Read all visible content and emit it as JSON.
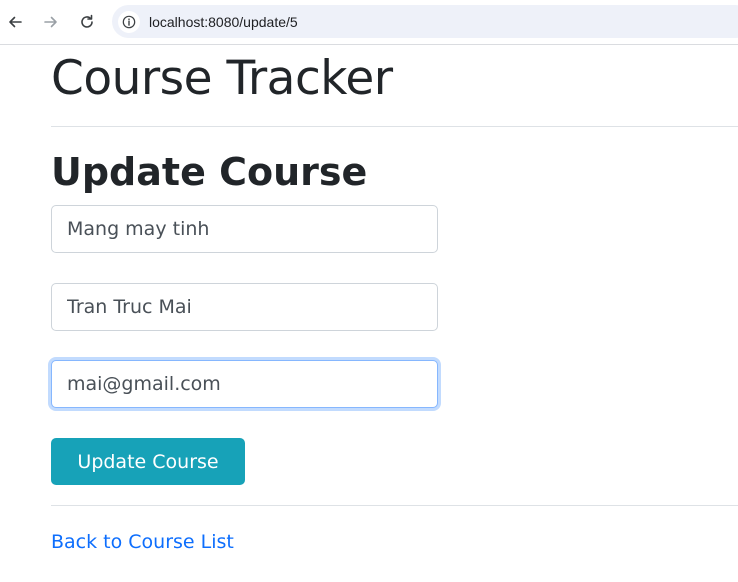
{
  "browser": {
    "url": "localhost:8080/update/5",
    "icons": [
      "back-arrow-icon",
      "forward-arrow-icon",
      "reload-icon",
      "info-icon"
    ]
  },
  "page": {
    "app_title": "Course Tracker",
    "form_title": "Update Course",
    "fields": [
      {
        "value": "Mang may tinh"
      },
      {
        "value": "Tran Truc Mai"
      },
      {
        "value": "mai@gmail.com",
        "focused": true
      }
    ],
    "submit_label": "Update Course",
    "back_link": "Back to Course List"
  },
  "colors": {
    "button_bg": "#17a2b8",
    "link": "#0d6efd",
    "focus_ring": "#86b7fe"
  }
}
